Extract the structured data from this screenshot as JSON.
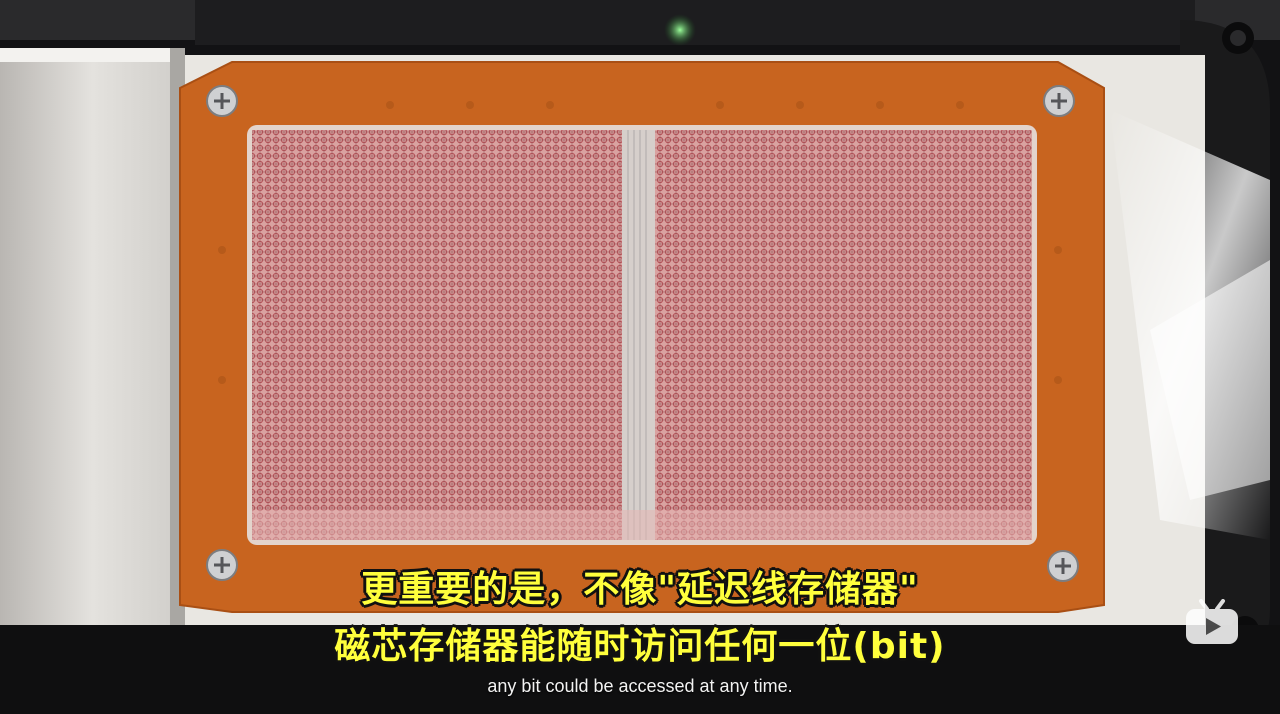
{
  "video": {
    "subtitle_cn_line1": "更重要的是，不像\"延迟线存储器\"",
    "subtitle_cn_line2": "磁芯存储器能随时访问任何一位(bit)",
    "subtitle_en": "any bit could be accessed at any time."
  },
  "logo": {
    "icon": "bilibili-tv-icon",
    "color": "#ffffff"
  },
  "colors": {
    "pcb_frame": "#c8641f",
    "core_mesh": "#c9646a",
    "background": "#0d0d0e",
    "subtitle_cn": "#ffff3c"
  }
}
